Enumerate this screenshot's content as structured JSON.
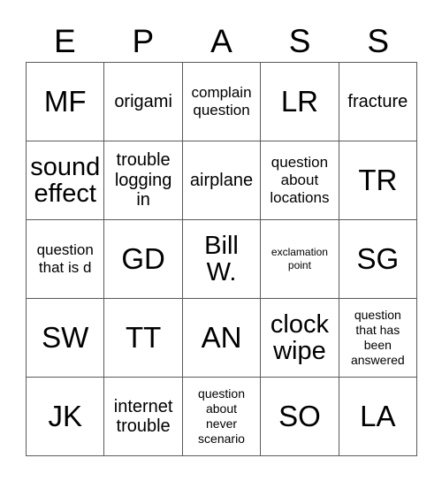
{
  "card": {
    "header_letters": [
      "E",
      "P",
      "A",
      "S",
      "S"
    ],
    "rows": [
      [
        {
          "text": "MF",
          "size": "xl"
        },
        {
          "text": "origami",
          "size": "md"
        },
        {
          "text": "complain\nquestion",
          "size": "sm"
        },
        {
          "text": "LR",
          "size": "xl"
        },
        {
          "text": "fracture",
          "size": "md"
        }
      ],
      [
        {
          "text": "sound\neffect",
          "size": "lg"
        },
        {
          "text": "trouble\nlogging\nin",
          "size": "md"
        },
        {
          "text": "airplane",
          "size": "md"
        },
        {
          "text": "question\nabout\nlocations",
          "size": "sm"
        },
        {
          "text": "TR",
          "size": "xl"
        }
      ],
      [
        {
          "text": "question\nthat is d",
          "size": "sm"
        },
        {
          "text": "GD",
          "size": "xl"
        },
        {
          "text": "Bill\nW.",
          "size": "lg"
        },
        {
          "text": "exclamation\npoint",
          "size": "xxs"
        },
        {
          "text": "SG",
          "size": "xl"
        }
      ],
      [
        {
          "text": "SW",
          "size": "xl"
        },
        {
          "text": "TT",
          "size": "xl"
        },
        {
          "text": "AN",
          "size": "xl"
        },
        {
          "text": "clock\nwipe",
          "size": "lg"
        },
        {
          "text": "question\nthat has\nbeen\nanswered",
          "size": "xs"
        }
      ],
      [
        {
          "text": "JK",
          "size": "xl"
        },
        {
          "text": "internet\ntrouble",
          "size": "md"
        },
        {
          "text": "question\nabout\nnever\nscenario",
          "size": "xs"
        },
        {
          "text": "SO",
          "size": "xl"
        },
        {
          "text": "LA",
          "size": "xl"
        }
      ]
    ]
  },
  "colors": {
    "background": "#ffffff",
    "grid_line": "#5a5a5a",
    "text": "#000000"
  }
}
